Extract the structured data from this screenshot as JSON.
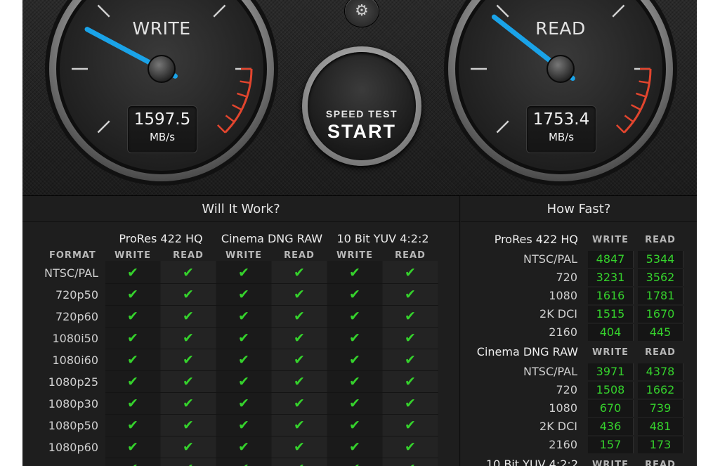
{
  "write_gauge": {
    "title": "WRITE",
    "value": "1597.5",
    "unit": "MB/s"
  },
  "read_gauge": {
    "title": "READ",
    "value": "1753.4",
    "unit": "MB/s"
  },
  "start": {
    "sub_label": "SPEED TEST",
    "main_label": "START"
  },
  "icons": {
    "settings": "gear-icon",
    "check": "check-icon"
  },
  "colors": {
    "needle": "#1aa3e8",
    "redline": "#e2452e",
    "check": "#35d22c",
    "value_text": "#35d22c"
  },
  "will_it_work": {
    "title": "Will It Work?",
    "format_label": "FORMAT",
    "groups": [
      {
        "name": "ProRes 422 HQ",
        "write": "WRITE",
        "read": "READ"
      },
      {
        "name": "Cinema DNG RAW",
        "write": "WRITE",
        "read": "READ"
      },
      {
        "name": "10 Bit YUV 4:2:2",
        "write": "WRITE",
        "read": "READ"
      }
    ],
    "formats": [
      "NTSC/PAL",
      "720p50",
      "720p60",
      "1080i50",
      "1080i60",
      "1080p25",
      "1080p30",
      "1080p50",
      "1080p60"
    ],
    "check_glyph": "✔"
  },
  "how_fast": {
    "title": "How Fast?",
    "groups": [
      {
        "name": "ProRes 422 HQ",
        "write": "WRITE",
        "read": "READ",
        "rows": [
          {
            "res": "NTSC/PAL",
            "write": "4847",
            "read": "5344"
          },
          {
            "res": "720",
            "write": "3231",
            "read": "3562"
          },
          {
            "res": "1080",
            "write": "1616",
            "read": "1781"
          },
          {
            "res": "2K DCI",
            "write": "1515",
            "read": "1670"
          },
          {
            "res": "2160",
            "write": "404",
            "read": "445"
          }
        ]
      },
      {
        "name": "Cinema DNG RAW",
        "write": "WRITE",
        "read": "READ",
        "rows": [
          {
            "res": "NTSC/PAL",
            "write": "3971",
            "read": "4378"
          },
          {
            "res": "720",
            "write": "1508",
            "read": "1662"
          },
          {
            "res": "1080",
            "write": "670",
            "read": "739"
          },
          {
            "res": "2K DCI",
            "write": "436",
            "read": "481"
          },
          {
            "res": "2160",
            "write": "157",
            "read": "173"
          }
        ]
      },
      {
        "name": "10 Bit YUV 4:2:2",
        "write": "WRITE",
        "read": "READ",
        "rows": []
      }
    ]
  }
}
